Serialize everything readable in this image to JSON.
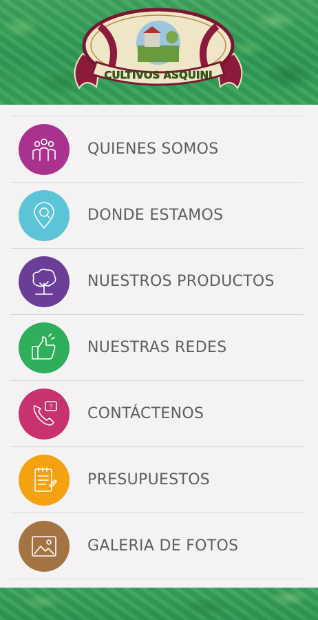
{
  "header": {
    "logo_text": "CULTIVOS ASQUINI",
    "background": "#2f9a55"
  },
  "menu": {
    "items": [
      {
        "label": "QUIENES SOMOS",
        "icon": "people-icon",
        "color": "#a9328f"
      },
      {
        "label": "DONDE ESTAMOS",
        "icon": "location-pin-icon",
        "color": "#5cc4d6"
      },
      {
        "label": "NUESTROS PRODUCTOS",
        "icon": "tree-icon",
        "color": "#6a3d96"
      },
      {
        "label": "NUESTRAS REDES",
        "icon": "thumbs-up-icon",
        "color": "#2fae5b"
      },
      {
        "label": "CONTÁCTENOS",
        "icon": "phone-question-icon",
        "color": "#c8326f"
      },
      {
        "label": "PRESUPUESTOS",
        "icon": "notepad-icon",
        "color": "#f4a20f"
      },
      {
        "label": "GALERIA DE FOTOS",
        "icon": "picture-icon",
        "color": "#a47344"
      }
    ]
  }
}
